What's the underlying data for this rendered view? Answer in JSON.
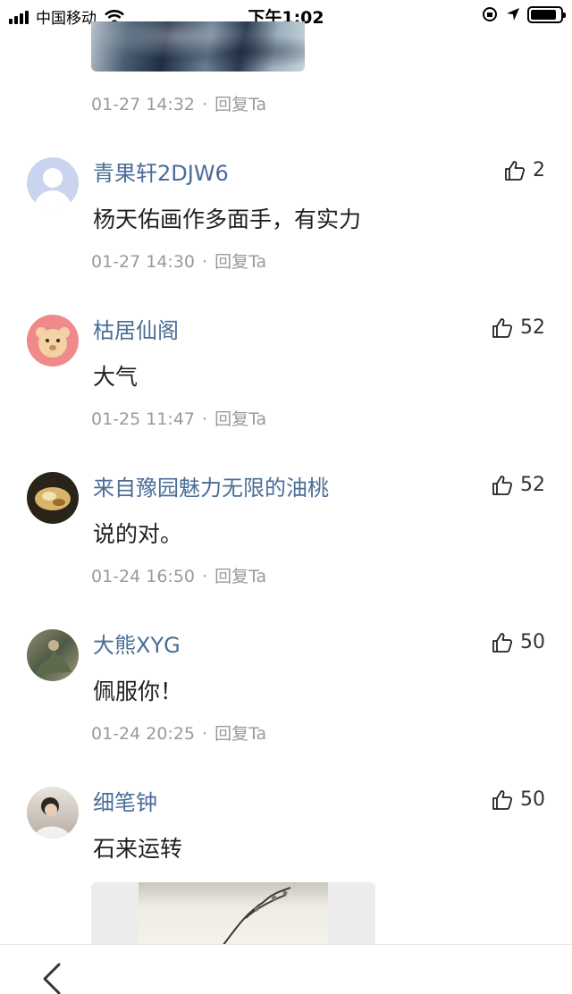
{
  "status_bar": {
    "carrier": "中国移动",
    "time": "下午1:02"
  },
  "top_comment": {
    "date": "01-27 14:32",
    "reply_label": "回复Ta"
  },
  "comments": [
    {
      "username": "青果轩2DJW6",
      "likes": "2",
      "content": "杨天佑画作多面手，有实力",
      "date": "01-27 14:30",
      "reply_label": "回复Ta"
    },
    {
      "username": "枯居仙阁",
      "likes": "52",
      "content": "大气",
      "date": "01-25 11:47",
      "reply_label": "回复Ta"
    },
    {
      "username": "来自豫园魅力无限的油桃",
      "likes": "52",
      "content": "说的对。",
      "date": "01-24 16:50",
      "reply_label": "回复Ta"
    },
    {
      "username": "大熊XYG",
      "likes": "50",
      "content": "佩服你！",
      "date": "01-24 20:25",
      "reply_label": "回复Ta"
    },
    {
      "username": "细笔钟",
      "likes": "50",
      "content": "石来运转"
    }
  ],
  "icons": {
    "like": "thumbs-up-icon",
    "back": "chevron-left-icon"
  },
  "colors": {
    "username": "#4a6d96",
    "meta": "#9a9a9a"
  }
}
